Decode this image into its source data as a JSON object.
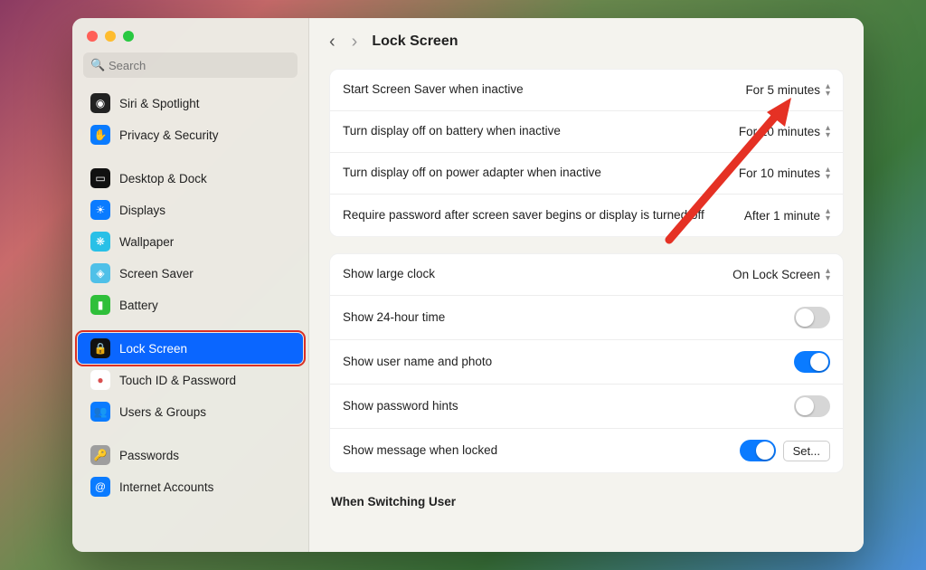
{
  "search": {
    "placeholder": "Search"
  },
  "sidebar": {
    "items": [
      {
        "label": "Siri & Spotlight",
        "bg": "#222",
        "glyph": "◉"
      },
      {
        "label": "Privacy & Security",
        "bg": "#0a7bff",
        "glyph": "✋"
      },
      {
        "label": "Desktop & Dock",
        "bg": "#111",
        "glyph": "▭"
      },
      {
        "label": "Displays",
        "bg": "#0a7bff",
        "glyph": "☀"
      },
      {
        "label": "Wallpaper",
        "bg": "#29c0e7",
        "glyph": "❋"
      },
      {
        "label": "Screen Saver",
        "bg": "#4fc0e8",
        "glyph": "◈"
      },
      {
        "label": "Battery",
        "bg": "#2fbf3a",
        "glyph": "▮"
      },
      {
        "label": "Lock Screen",
        "bg": "#111",
        "glyph": "🔒"
      },
      {
        "label": "Touch ID & Password",
        "bg": "#fff",
        "glyph": "●",
        "fg": "#d94f4f"
      },
      {
        "label": "Users & Groups",
        "bg": "#0a7bff",
        "glyph": "👥"
      },
      {
        "label": "Passwords",
        "bg": "#9e9e9e",
        "glyph": "🔑"
      },
      {
        "label": "Internet Accounts",
        "bg": "#0a7bff",
        "glyph": "@"
      }
    ]
  },
  "page_title": "Lock Screen",
  "section1": [
    {
      "label": "Start Screen Saver when inactive",
      "value": "For 5 minutes"
    },
    {
      "label": "Turn display off on battery when inactive",
      "value": "For 10 minutes"
    },
    {
      "label": "Turn display off on power adapter when inactive",
      "value": "For 10 minutes"
    },
    {
      "label": "Require password after screen saver begins or display is turned off",
      "value": "After 1 minute"
    }
  ],
  "section2": {
    "large_clock": {
      "label": "Show large clock",
      "value": "On Lock Screen"
    },
    "hour24": {
      "label": "Show 24-hour time",
      "on": false
    },
    "user_name_photo": {
      "label": "Show user name and photo",
      "on": true
    },
    "password_hints": {
      "label": "Show password hints",
      "on": false
    },
    "show_message": {
      "label": "Show message when locked",
      "on": true,
      "button": "Set..."
    }
  },
  "switching_header": "When Switching User"
}
